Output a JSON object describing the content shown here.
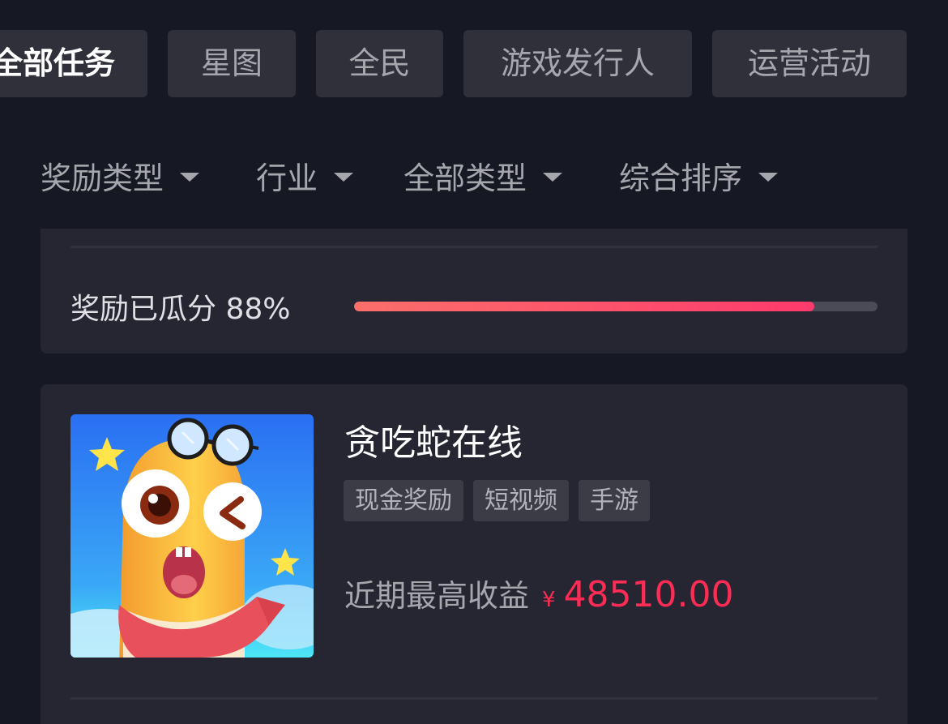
{
  "tabs": [
    {
      "label": "全部任务",
      "active": true
    },
    {
      "label": "星图",
      "active": false
    },
    {
      "label": "全民",
      "active": false
    },
    {
      "label": "游戏发行人",
      "active": false
    },
    {
      "label": "运营活动",
      "active": false
    }
  ],
  "filters": [
    {
      "label": "奖励类型",
      "icon": "caret-down-icon"
    },
    {
      "label": "行业",
      "icon": "caret-down-icon"
    },
    {
      "label": "全部类型",
      "icon": "caret-down-icon"
    },
    {
      "label": "综合排序",
      "icon": "caret-down-icon"
    }
  ],
  "reward_progress": {
    "label": "奖励已瓜分 88%",
    "percent": 88
  },
  "task": {
    "title": "贪吃蛇在线",
    "tags": [
      "现金奖励",
      "短视频",
      "手游"
    ],
    "earnings_label": "近期最高收益",
    "currency_symbol": "¥",
    "earnings_value": "48510.00"
  },
  "colors": {
    "background": "#161823",
    "card": "#252632",
    "accent": "#fe2c55",
    "progress_start": "#fb6f6a",
    "progress_end": "#fd3a6c"
  }
}
